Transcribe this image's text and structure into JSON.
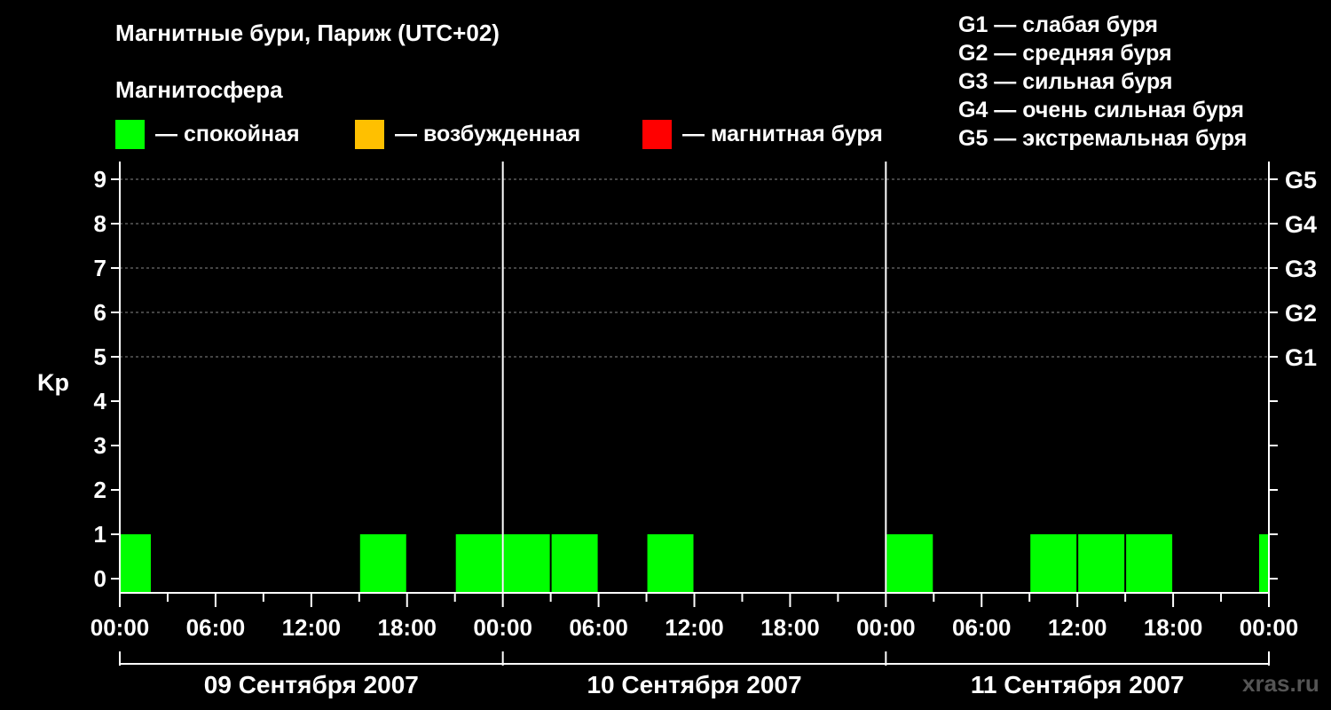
{
  "chart_data": {
    "type": "bar",
    "title": "Магнитные бури, Париж (UTC+02)",
    "subtitle": "Магнитосфера",
    "ylabel": "Kp",
    "ylim": [
      0,
      9
    ],
    "yticks": [
      "0",
      "1",
      "2",
      "3",
      "4",
      "5",
      "6",
      "7",
      "8",
      "9"
    ],
    "right_ticks": [
      {
        "kp": 5,
        "label": "G1"
      },
      {
        "kp": 6,
        "label": "G2"
      },
      {
        "kp": 7,
        "label": "G3"
      },
      {
        "kp": 8,
        "label": "G4"
      },
      {
        "kp": 9,
        "label": "G5"
      }
    ],
    "xticks": [
      "00:00",
      "06:00",
      "12:00",
      "18:00",
      "00:00",
      "06:00",
      "12:00",
      "18:00",
      "00:00",
      "06:00",
      "12:00",
      "18:00",
      "00:00"
    ],
    "dates": [
      "09 Сентября 2007",
      "10 Сентября 2007",
      "11 Сентября 2007"
    ],
    "legend": [
      {
        "label": "— спокойная",
        "color": "#00ff00"
      },
      {
        "label": "— возбужденная",
        "color": "#ffc000"
      },
      {
        "label": "— магнитная буря",
        "color": "#ff0000"
      }
    ],
    "g_scale": [
      "G1 — слабая буря",
      "G2 — средняя буря",
      "G3 — сильная буря",
      "G4 — очень сильная буря",
      "G5 — экстремальная буря"
    ],
    "series": [
      {
        "values": [
          {
            "start_hour": 0,
            "end_hour": 2,
            "kp": 1
          },
          {
            "start_hour": 15,
            "end_hour": 18,
            "kp": 1
          },
          {
            "start_hour": 21,
            "end_hour": 24,
            "kp": 1
          },
          {
            "start_hour": 24,
            "end_hour": 27,
            "kp": 1
          },
          {
            "start_hour": 27,
            "end_hour": 30,
            "kp": 1
          },
          {
            "start_hour": 33,
            "end_hour": 36,
            "kp": 1
          },
          {
            "start_hour": 48,
            "end_hour": 51,
            "kp": 1
          },
          {
            "start_hour": 57,
            "end_hour": 60,
            "kp": 1
          },
          {
            "start_hour": 60,
            "end_hour": 63,
            "kp": 1
          },
          {
            "start_hour": 63,
            "end_hour": 66,
            "kp": 1
          },
          {
            "start_hour": 72,
            "end_hour": 72,
            "kp": 1
          }
        ]
      }
    ],
    "bar_color": "#00ff00"
  },
  "watermark": "xras.ru"
}
